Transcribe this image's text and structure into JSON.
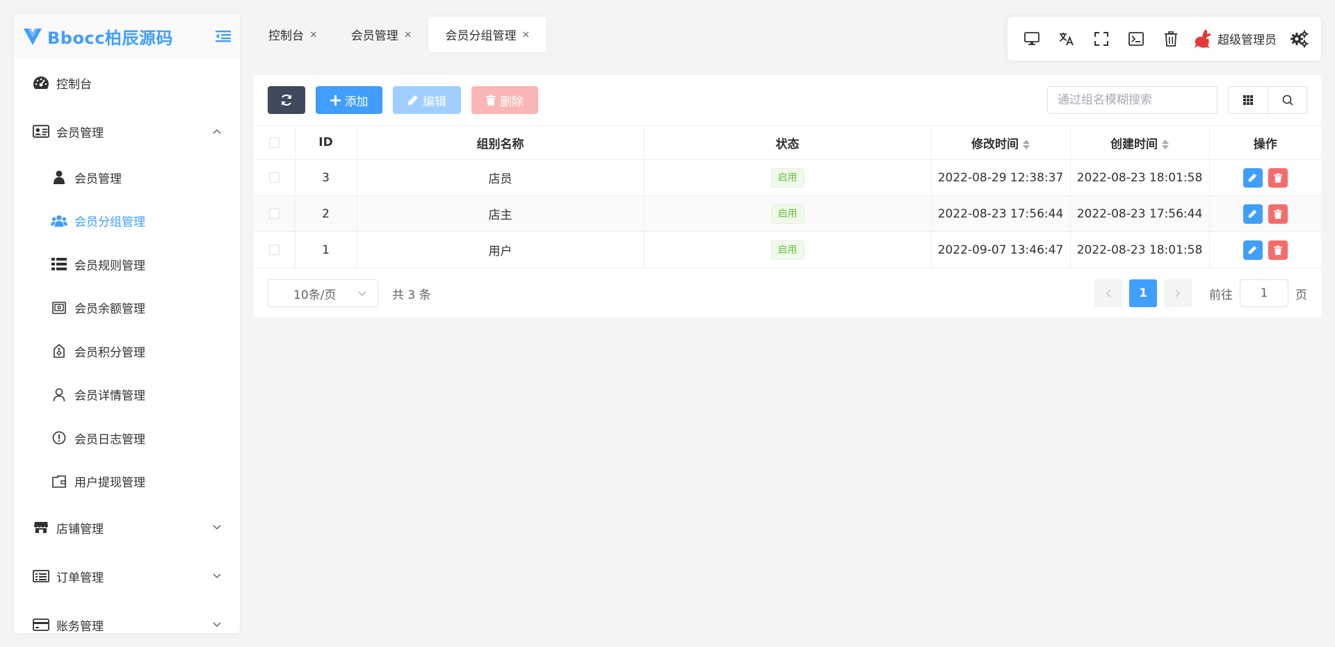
{
  "app": {
    "logo_text": "Bbocc柏辰源码"
  },
  "sidebar": {
    "items": [
      {
        "label": "控制台",
        "icon": "dashboard-icon"
      },
      {
        "label": "会员管理",
        "icon": "id-card-icon",
        "expanded": true,
        "children": [
          {
            "label": "会员管理",
            "icon": "user-icon"
          },
          {
            "label": "会员分组管理",
            "icon": "users-icon",
            "active": true
          },
          {
            "label": "会员规则管理",
            "icon": "list-icon"
          },
          {
            "label": "会员余额管理",
            "icon": "wallet-icon"
          },
          {
            "label": "会员积分管理",
            "icon": "points-tag-icon"
          },
          {
            "label": "会员详情管理",
            "icon": "person-outline-icon"
          },
          {
            "label": "会员日志管理",
            "icon": "info-circle-icon"
          },
          {
            "label": "用户提现管理",
            "icon": "folder-icon"
          }
        ]
      },
      {
        "label": "店铺管理",
        "icon": "store-icon"
      },
      {
        "label": "订单管理",
        "icon": "order-list-icon"
      },
      {
        "label": "账务管理",
        "icon": "credit-card-icon"
      }
    ]
  },
  "tabs": [
    {
      "label": "控制台",
      "close": "×"
    },
    {
      "label": "会员管理",
      "close": "×"
    },
    {
      "label": "会员分组管理",
      "close": "×",
      "active": true
    }
  ],
  "topbar": {
    "user_name": "超级管理员"
  },
  "toolbar": {
    "add_label": "添加",
    "edit_label": "编辑",
    "delete_label": "删除",
    "search_placeholder": "通过组名模糊搜索"
  },
  "table": {
    "columns": [
      "ID",
      "组别名称",
      "状态",
      "修改时间",
      "创建时间",
      "操作"
    ],
    "rows": [
      {
        "id": "3",
        "name": "店员",
        "status": "启用",
        "updated": "2022-08-29 12:38:37",
        "created": "2022-08-23 18:01:58"
      },
      {
        "id": "2",
        "name": "店主",
        "status": "启用",
        "updated": "2022-08-23 17:56:44",
        "created": "2022-08-23 17:56:44"
      },
      {
        "id": "1",
        "name": "用户",
        "status": "启用",
        "updated": "2022-09-07 13:46:47",
        "created": "2022-08-23 18:01:58"
      }
    ]
  },
  "pagination": {
    "page_size": "10条/页",
    "total": "共 3 条",
    "current_page": "1",
    "goto_prefix": "前往",
    "goto_value": "1",
    "goto_suffix": "页"
  },
  "colors": {
    "primary": "#409eff",
    "danger": "#f56c6c",
    "success": "#67c23a",
    "dark": "#40485b"
  }
}
